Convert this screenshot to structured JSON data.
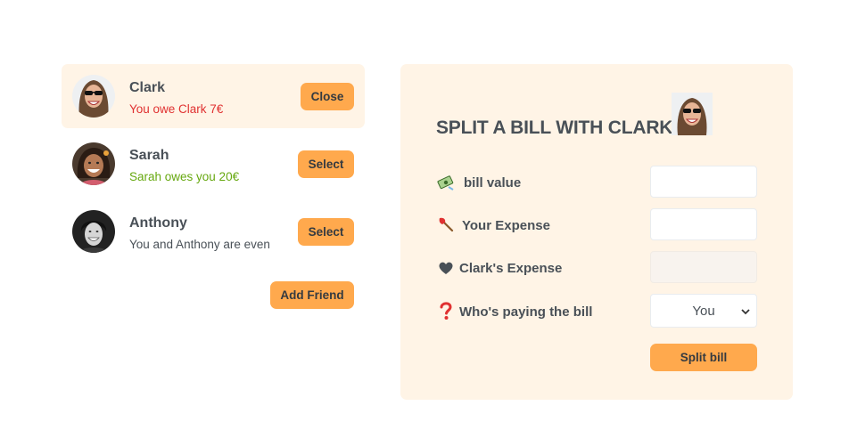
{
  "friends": [
    {
      "name": "Clark",
      "status": "You owe Clark 7€",
      "button": "Close"
    },
    {
      "name": "Sarah",
      "status": "Sarah owes you 20€",
      "button": "Select"
    },
    {
      "name": "Anthony",
      "status": "You and Anthony are even",
      "button": "Select"
    }
  ],
  "add_friend_label": "Add Friend",
  "form": {
    "title": "SPLIT A BILL WITH CLARK",
    "bill_value_label": "bill value",
    "your_expense_label": "Your Expense",
    "friend_expense_label": "Clark's Expense",
    "payer_label": "Who's paying the bill",
    "payer_selected": "You",
    "split_button": "Split bill"
  },
  "colors": {
    "accent": "#ffa94d",
    "panel": "#fff4e6",
    "owe": "#e03131",
    "owed": "#66a80f"
  },
  "icons": [
    "money-icon",
    "axe-icon",
    "heart-icon",
    "question-icon",
    "chevron-down-icon"
  ]
}
